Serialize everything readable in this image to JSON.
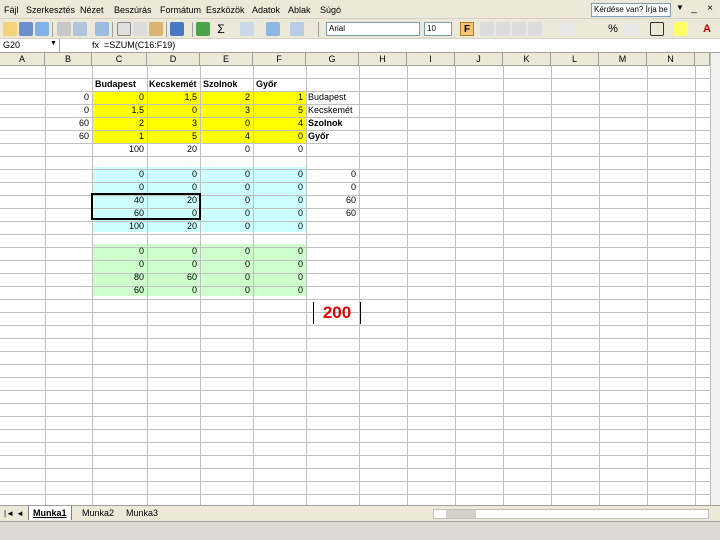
{
  "menu": [
    "Fájl",
    "Szerkesztés",
    "Nézet",
    "Beszúrás",
    "Formátum",
    "Eszközök",
    "Adatok",
    "Ablak",
    "Súgó"
  ],
  "help_placeholder": "Kérdése van? Írja be ide",
  "font_name": "Arial",
  "font_size": "10",
  "bold_label": "F",
  "cell_ref": "G20",
  "fx_label": "fx",
  "formula": "=SZUM(C16:F19)",
  "columns": [
    "A",
    "B",
    "C",
    "D",
    "E",
    "F",
    "G",
    "H",
    "I",
    "J",
    "K",
    "L",
    "M",
    "N"
  ],
  "header_row": [
    "Budapest",
    "Kecskemét",
    "Szolnok",
    "Győr"
  ],
  "row_labels": [
    "Budapest",
    "Kecskemét",
    "Szolnok",
    "Győr"
  ],
  "yellow_rows": [
    {
      "b": "0",
      "c": "0",
      "d": "1,5",
      "e": "2",
      "f": "1"
    },
    {
      "b": "0",
      "c": "1,5",
      "d": "0",
      "e": "3",
      "f": "5"
    },
    {
      "b": "60",
      "c": "2",
      "d": "3",
      "e": "0",
      "f": "4"
    },
    {
      "b": "60",
      "c": "1",
      "d": "5",
      "e": "4",
      "f": "0"
    }
  ],
  "yellow_totals": [
    "100",
    "20",
    "0",
    "0"
  ],
  "cyan_rows": [
    {
      "c": "0",
      "d": "0",
      "e": "0",
      "f": "0",
      "g": "0"
    },
    {
      "c": "0",
      "d": "0",
      "e": "0",
      "f": "0",
      "g": "0"
    },
    {
      "c": "40",
      "d": "20",
      "e": "0",
      "f": "0",
      "g": "60"
    },
    {
      "c": "60",
      "d": "0",
      "e": "0",
      "f": "0",
      "g": "60"
    }
  ],
  "cyan_totals": [
    "100",
    "20",
    "0",
    "0"
  ],
  "green_rows": [
    {
      "c": "0",
      "d": "0",
      "e": "0",
      "f": "0"
    },
    {
      "c": "0",
      "d": "0",
      "e": "0",
      "f": "0"
    },
    {
      "c": "80",
      "d": "60",
      "e": "0",
      "f": "0"
    },
    {
      "c": "60",
      "d": "0",
      "e": "0",
      "f": "0"
    }
  ],
  "result": "200",
  "sheets": [
    "Munka1",
    "Munka2",
    "Munka3"
  ],
  "colors": {
    "yellow": "#ffff00",
    "cyan": "#ccffff",
    "green": "#ccffcc",
    "result": "#e00000"
  }
}
